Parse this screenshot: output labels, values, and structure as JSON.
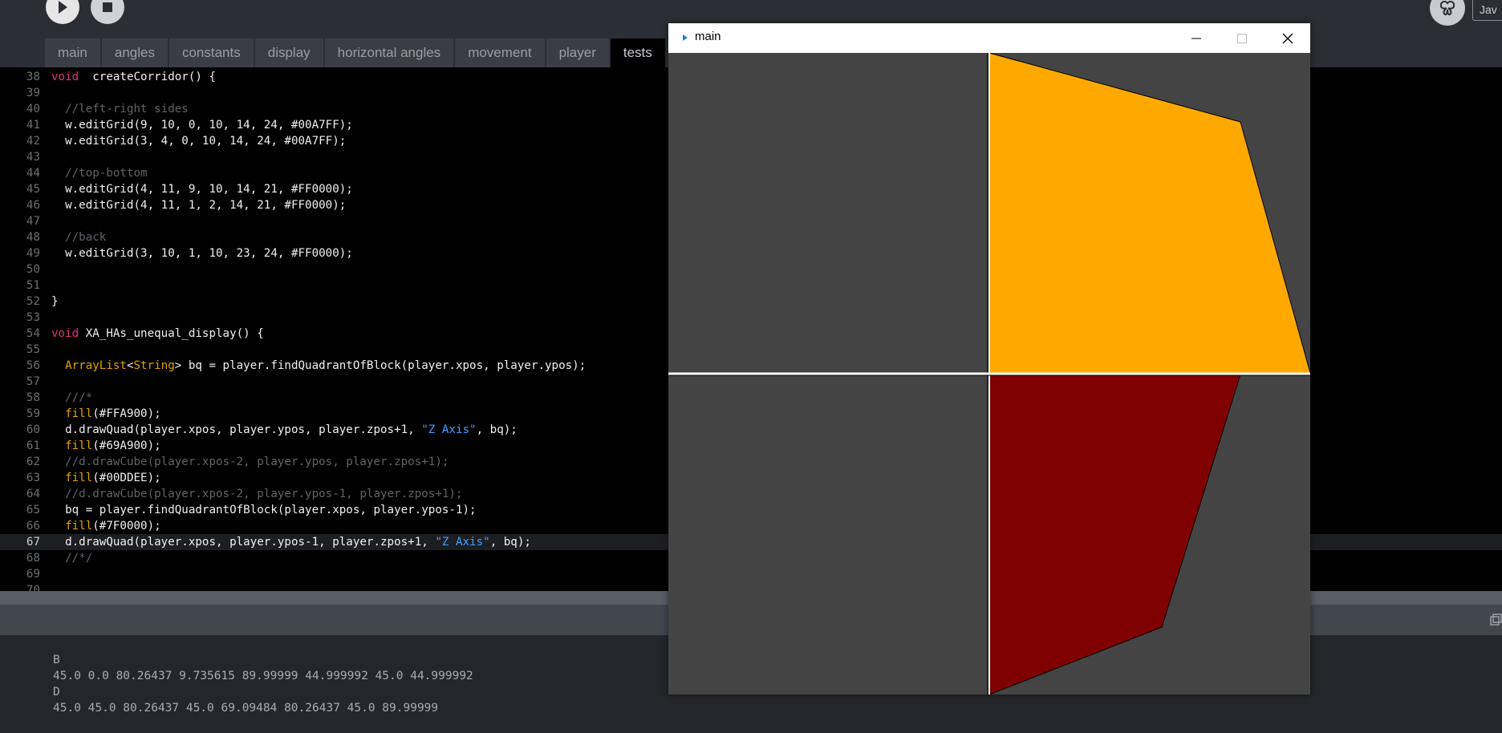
{
  "toolbar": {
    "run_icon": "play-icon",
    "stop_icon": "stop-icon",
    "mode_icon": "butterfly-icon",
    "mode_label": "Jav"
  },
  "tabs": [
    {
      "label": "main"
    },
    {
      "label": "angles"
    },
    {
      "label": "constants"
    },
    {
      "label": "display"
    },
    {
      "label": "horizontal angles"
    },
    {
      "label": "movement"
    },
    {
      "label": "player"
    },
    {
      "label": "tests"
    }
  ],
  "active_tab": "tests",
  "editor": {
    "current_line": "67",
    "lines": [
      {
        "n": "38",
        "segs": [
          [
            "kw",
            "void"
          ],
          [
            "",
            "  createCorridor() {"
          ]
        ]
      },
      {
        "n": "39",
        "segs": []
      },
      {
        "n": "40",
        "segs": [
          [
            "",
            "  "
          ],
          [
            "cm",
            "//left-right sides"
          ]
        ]
      },
      {
        "n": "41",
        "segs": [
          [
            "",
            "  w.editGrid(9, 10, 0, 10, 14, 24, #00A7FF);"
          ]
        ]
      },
      {
        "n": "42",
        "segs": [
          [
            "",
            "  w.editGrid(3, 4, 0, 10, 14, 24, #00A7FF);"
          ]
        ]
      },
      {
        "n": "43",
        "segs": []
      },
      {
        "n": "44",
        "segs": [
          [
            "",
            "  "
          ],
          [
            "cm",
            "//top-bottom"
          ]
        ]
      },
      {
        "n": "45",
        "segs": [
          [
            "",
            "  w.editGrid(4, 11, 9, 10, 14, 21, #FF0000);"
          ]
        ]
      },
      {
        "n": "46",
        "segs": [
          [
            "",
            "  w.editGrid(4, 11, 1, 2, 14, 21, #FF0000);"
          ]
        ]
      },
      {
        "n": "47",
        "segs": []
      },
      {
        "n": "48",
        "segs": [
          [
            "",
            "  "
          ],
          [
            "cm",
            "//back"
          ]
        ]
      },
      {
        "n": "49",
        "segs": [
          [
            "",
            "  w.editGrid(3, 10, 1, 10, 23, 24, #FF0000);"
          ]
        ]
      },
      {
        "n": "50",
        "segs": []
      },
      {
        "n": "51",
        "segs": []
      },
      {
        "n": "52",
        "segs": [
          [
            "",
            "}"
          ]
        ]
      },
      {
        "n": "53",
        "segs": []
      },
      {
        "n": "54",
        "segs": [
          [
            "kw",
            "void"
          ],
          [
            "",
            " XA_HAs_unequal_display() {"
          ]
        ]
      },
      {
        "n": "55",
        "segs": []
      },
      {
        "n": "56",
        "segs": [
          [
            "",
            "  "
          ],
          [
            "ty",
            "ArrayList"
          ],
          [
            "",
            "<"
          ],
          [
            "ty",
            "String"
          ],
          [
            "",
            "> bq = player.findQuadrantOfBlock(player.xpos, player.ypos);"
          ]
        ]
      },
      {
        "n": "57",
        "segs": []
      },
      {
        "n": "58",
        "segs": [
          [
            "",
            "  "
          ],
          [
            "cm",
            "///*"
          ]
        ]
      },
      {
        "n": "59",
        "segs": [
          [
            "",
            "  "
          ],
          [
            "fn",
            "fill"
          ],
          [
            "",
            "(#FFA900);"
          ]
        ]
      },
      {
        "n": "60",
        "segs": [
          [
            "",
            "  d.drawQuad(player.xpos, player.ypos, player.zpos+1, "
          ],
          [
            "str",
            "\"Z Axis\""
          ],
          [
            "",
            ", bq);"
          ]
        ]
      },
      {
        "n": "61",
        "segs": [
          [
            "",
            "  "
          ],
          [
            "fn",
            "fill"
          ],
          [
            "",
            "(#69A900);"
          ]
        ]
      },
      {
        "n": "62",
        "segs": [
          [
            "",
            "  "
          ],
          [
            "cm",
            "//d.drawCube(player.xpos-2, player.ypos, player.zpos+1);"
          ]
        ]
      },
      {
        "n": "63",
        "segs": [
          [
            "",
            "  "
          ],
          [
            "fn",
            "fill"
          ],
          [
            "",
            "(#00DDEE);"
          ]
        ]
      },
      {
        "n": "64",
        "segs": [
          [
            "",
            "  "
          ],
          [
            "cm",
            "//d.drawCube(player.xpos-2, player.ypos-1, player.zpos+1);"
          ]
        ]
      },
      {
        "n": "65",
        "segs": [
          [
            "",
            "  bq = player.findQuadrantOfBlock(player.xpos, player.ypos-1);"
          ]
        ]
      },
      {
        "n": "66",
        "segs": [
          [
            "",
            "  "
          ],
          [
            "fn",
            "fill"
          ],
          [
            "",
            "(#7F0000);"
          ]
        ]
      },
      {
        "n": "67",
        "segs": [
          [
            "",
            "  d.drawQuad(player.xpos, player.ypos-1, player.zpos+1, "
          ],
          [
            "str",
            "\"Z Axis\""
          ],
          [
            "",
            ", bq);"
          ]
        ]
      },
      {
        "n": "68",
        "segs": [
          [
            "",
            "  "
          ],
          [
            "cm",
            "//*/"
          ]
        ]
      },
      {
        "n": "69",
        "segs": []
      },
      {
        "n": "70",
        "segs": []
      }
    ]
  },
  "console": {
    "lines": [
      "B",
      "45.0 0.0 80.26437 9.735615 89.99999 44.999992 45.0 44.999992",
      "D",
      "45.0 45.0 80.26437 45.0 69.09484 80.26437 45.0 89.99999"
    ]
  },
  "sketch_window": {
    "title": "main",
    "background": "#444444",
    "quads": [
      {
        "fill": "#FFA900"
      },
      {
        "fill": "#7F0000"
      }
    ]
  }
}
